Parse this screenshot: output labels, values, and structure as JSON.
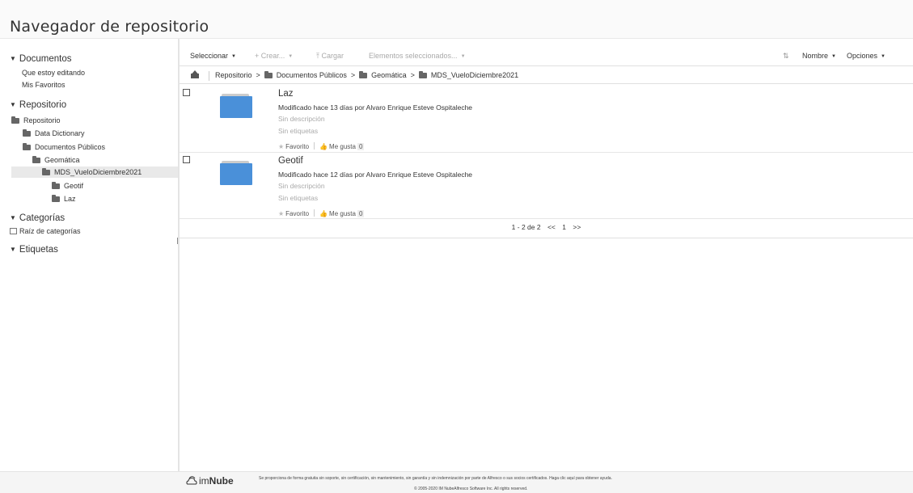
{
  "page": {
    "title": "Navegador de repositorio"
  },
  "sidebar": {
    "documents": {
      "heading": "Documentos",
      "links": [
        "Que estoy editando",
        "Mis Favoritos"
      ]
    },
    "repository": {
      "heading": "Repositorio",
      "tree": [
        {
          "label": "Repositorio"
        },
        {
          "label": "Data Dictionary"
        },
        {
          "label": "Documentos Públicos"
        },
        {
          "label": "Geomática"
        },
        {
          "label": "MDS_VueloDiciembre2021",
          "selected": true
        },
        {
          "label": "Geotif"
        },
        {
          "label": "Laz"
        }
      ]
    },
    "categories": {
      "heading": "Categorías",
      "root": "Raíz de categorías"
    },
    "tags": {
      "heading": "Etiquetas"
    }
  },
  "toolbar": {
    "select": "Seleccionar",
    "create": "Crear...",
    "upload": "Cargar",
    "selected_items": "Elementos seleccionados...",
    "sort": "Nombre",
    "options": "Opciones"
  },
  "breadcrumb": [
    "Repositorio",
    "Documentos Públicos",
    "Geomática",
    "MDS_VueloDiciembre2021"
  ],
  "items": [
    {
      "name": "Laz",
      "modified": "Modificado hace 13 días por Alvaro Enrique Esteve Ospitaleche",
      "description": "Sin descripción",
      "tags": "Sin etiquetas",
      "favorite": "Favorito",
      "like": "Me gusta",
      "like_count": "0"
    },
    {
      "name": "Geotif",
      "modified": "Modificado hace 12 días por Alvaro Enrique Esteve Ospitaleche",
      "description": "Sin descripción",
      "tags": "Sin etiquetas",
      "favorite": "Favorito",
      "like": "Me gusta",
      "like_count": "0"
    }
  ],
  "pager": {
    "range": "1 - 2 de 2",
    "prev": "<<",
    "page": "1",
    "next": ">>"
  },
  "footer": {
    "brand_light": "im",
    "brand_bold": "Nube",
    "notice": "Se proporciona de forma gratuita sin soporte, sin certificación, sin mantenimiento, sin garantía y sin indemnización por parte de Alfresco o sus socios certificados. Haga clic aquí para obtener ayuda.",
    "copyright": "© 2005-2020 IM NubeAlfresco Software Inc. All rights reserved."
  },
  "colors": {
    "folder": "#4a90d9",
    "selected_row": "#e9e9e9"
  }
}
